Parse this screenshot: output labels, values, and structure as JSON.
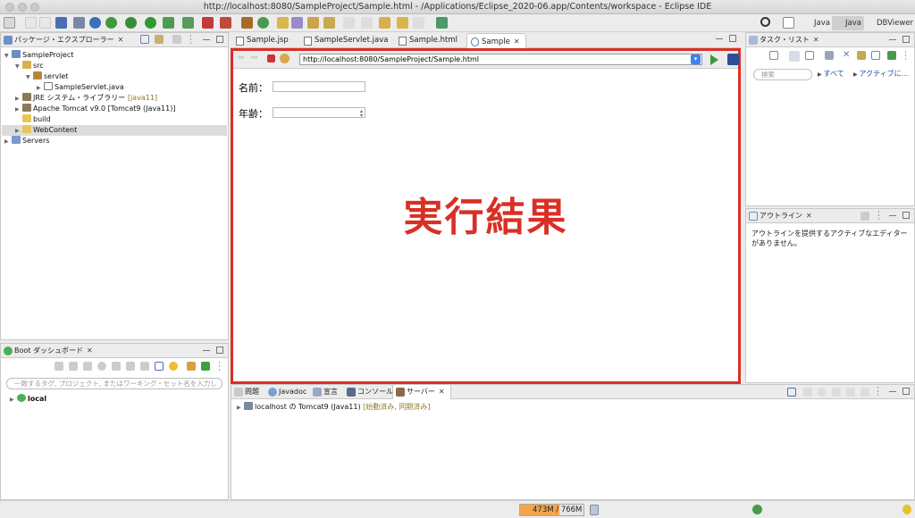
{
  "window": {
    "title": "http://localhost:8080/SampleProject/Sample.html - /Applications/Eclipse_2020-06.app/Contents/workspace - Eclipse IDE"
  },
  "perspectives": {
    "java": "Java",
    "java_active": "Java",
    "dbviewer": "DBViewer"
  },
  "package_explorer": {
    "title": "パッケージ・エクスプローラー",
    "tree": {
      "project": "SampleProject",
      "src": "src",
      "servlet": "servlet",
      "servlet_java": "SampleServlet.java",
      "jre": "JRE システム・ライブラリー",
      "jre_decor": "[java11]",
      "tomcat": "Apache Tomcat v9.0 [Tomcat9 (Java11)]",
      "build": "build",
      "webcontent": "WebContent",
      "servers": "Servers"
    }
  },
  "boot_dashboard": {
    "title": "Boot ダッシュボード",
    "filter_placeholder": "一致するタグ, プロジェクト, またはワーキング・セット名を入力し",
    "item": "local"
  },
  "editor": {
    "tabs": [
      "Sample.jsp",
      "SampleServlet.java",
      "Sample.html",
      "Sample"
    ],
    "url": "http://localhost:8080/SampleProject/Sample.html",
    "form": {
      "name_label": "名前：",
      "age_label": "年齢："
    },
    "overlay": "実行結果"
  },
  "task_list": {
    "title": "タスク・リスト",
    "search_placeholder": "検索",
    "all": "すべて",
    "active": "アクティブに..."
  },
  "outline": {
    "title": "アウトライン",
    "message": "アウトラインを提供するアクティブなエディターがありません。"
  },
  "bottom": {
    "tabs": [
      "問題",
      "Javadoc",
      "宣言",
      "コンソール",
      "サーバー"
    ],
    "server_name": "localhost の Tomcat9 (Java11)",
    "server_status": "[始動済み, 同期済み]"
  },
  "status": {
    "heap": "473M / 766M",
    "heap_fraction": 0.62
  },
  "colors": {
    "highlight": "#d93025"
  }
}
